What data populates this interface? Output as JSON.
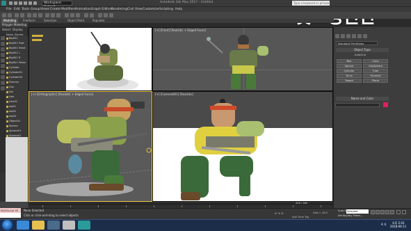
{
  "title_bar": {
    "workspace": "Workspace: Default",
    "window_title": "Autodesk 3ds Max 2017  -  Untitled",
    "search_placeholder": "Type a keyword or phrase"
  },
  "watermark": "깃모닝인천",
  "menu": [
    "File",
    "Edit",
    "Tools",
    "Group",
    "Views",
    "Create",
    "Modifiers",
    "Animation",
    "Graph Editors",
    "Rendering",
    "Civil View",
    "Customize",
    "Scripting",
    "Help"
  ],
  "ribbon": {
    "tabs": [
      "Modeling",
      "Freeform",
      "Selection",
      "Object Paint",
      "Populate"
    ],
    "active": "Modeling",
    "sub": "Polygon Modeling"
  },
  "scene_explorer": {
    "tabs": [
      "Select",
      "Display"
    ],
    "header": "Name (Sorted Ascending)",
    "items": [
      "Bip001",
      "Bip001 Foot",
      "Bip001 Head",
      "Bip001 L",
      "Bip001 R",
      "Bip001 Pelvis",
      "Cylinder",
      "Cylinder01",
      "Cylinder02",
      "Dummy",
      "Gun",
      "hat",
      "Hair",
      "Line01",
      "obj01",
      "obj02",
      "obj03",
      "Object01",
      "Sphere",
      "Sphere01",
      "Sphere02"
    ]
  },
  "viewports": {
    "top_label": "",
    "front_label": "[+] [Front] [Realistic + Edged Faces]",
    "ortho_label": "[+] [Orthographic] [Realistic + Edged Faces]",
    "camera_label": "[+] [Camera001] [Realistic]"
  },
  "command_panel": {
    "dropdown": "Standard Primitives",
    "object_type_header": "Object Type",
    "autogrid": "AutoGrid",
    "buttons": [
      "Box",
      "Cone",
      "Sphere",
      "GeoSphere",
      "Cylinder",
      "Tube",
      "Torus",
      "Pyramid",
      "Teapot",
      "Plane"
    ],
    "name_color_header": "Name and Color"
  },
  "timeline": {
    "counter": "200 / 300"
  },
  "status": {
    "maxscript": "MAXScript Mi",
    "line1": "None Selected",
    "line2": "Click or click-and-drag to select objects",
    "coords": "X:     Y:     Z:",
    "grid": "Grid = 10.0",
    "add_time_tag": "Add Time Tag",
    "auto_key": "Auto Key",
    "selected": "Selected",
    "set_key": "Set Key",
    "key_filters": "Key Filters..."
  },
  "taskbar": {
    "time": "오후 2:43",
    "date": "2018-06-11",
    "lang": "A 가"
  },
  "colors": {
    "accent": "#e8c040",
    "swatch": "#e02060"
  }
}
